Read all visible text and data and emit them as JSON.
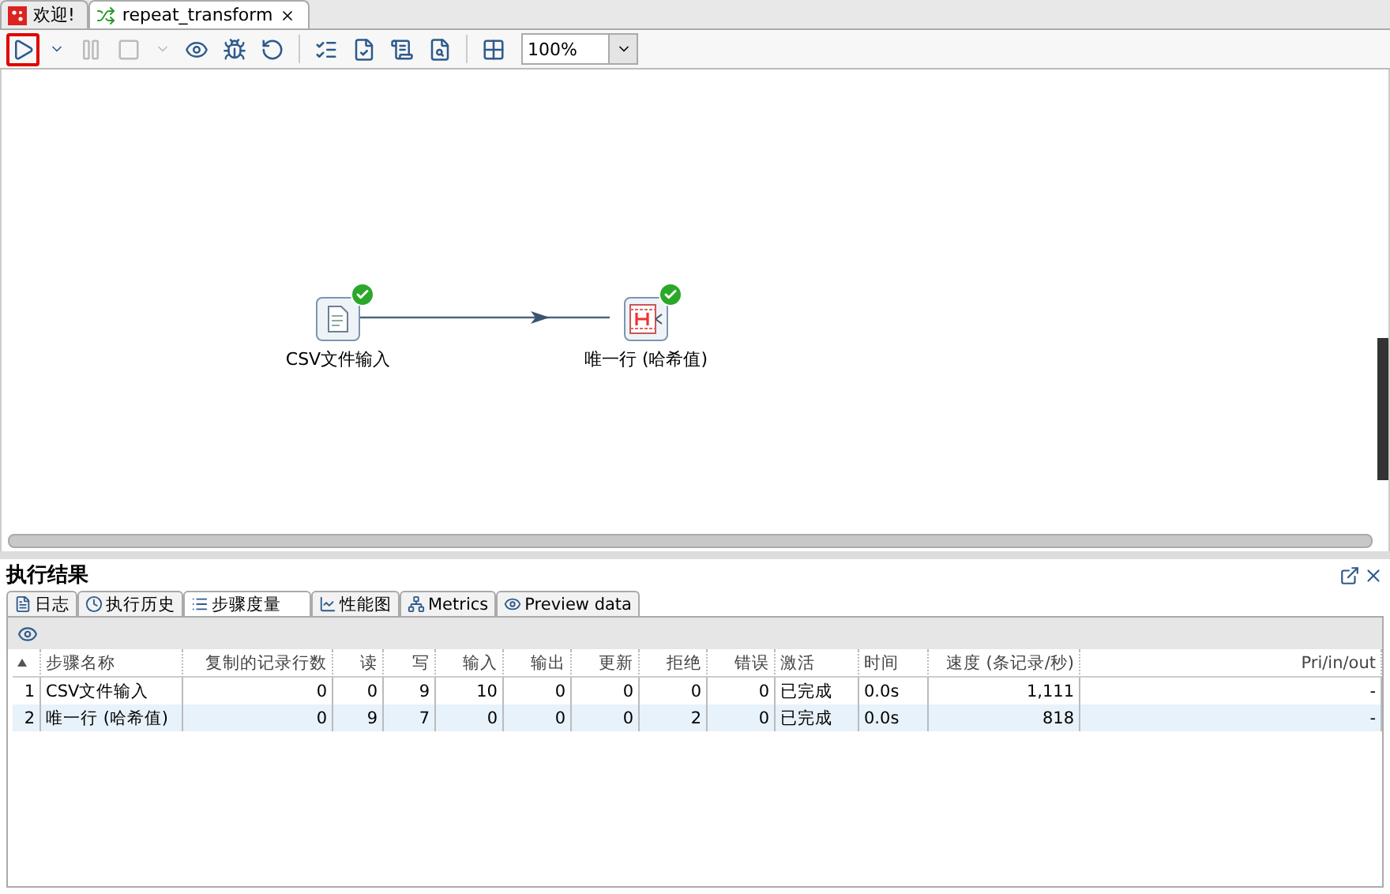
{
  "editor_tabs": [
    {
      "label": "欢迎!",
      "kind": "welcome",
      "selected": false,
      "closable": false
    },
    {
      "label": "repeat_transform",
      "kind": "transform",
      "selected": true,
      "closable": true
    }
  ],
  "toolbar": {
    "buttons": [
      {
        "kind": "run",
        "disabled": false,
        "highlighted": true
      },
      {
        "kind": "dropdown",
        "disabled": false,
        "highlighted": false
      },
      {
        "kind": "pause",
        "disabled": true,
        "highlighted": false
      },
      {
        "kind": "stop",
        "disabled": true,
        "highlighted": false
      },
      {
        "kind": "dropdown",
        "disabled": true,
        "highlighted": false
      },
      {
        "kind": "preview",
        "disabled": false,
        "highlighted": false
      },
      {
        "kind": "debug",
        "disabled": false,
        "highlighted": false
      },
      {
        "kind": "replay",
        "disabled": false,
        "highlighted": false
      },
      {
        "kind": "verify",
        "disabled": false,
        "highlighted": false
      },
      {
        "kind": "impact",
        "disabled": false,
        "highlighted": false
      },
      {
        "kind": "sql",
        "disabled": false,
        "highlighted": false
      },
      {
        "kind": "explore",
        "disabled": false,
        "highlighted": false
      },
      {
        "kind": "grid",
        "disabled": false,
        "highlighted": false
      }
    ],
    "zoom": "100%"
  },
  "canvas": {
    "nodes": [
      {
        "label": "CSV文件输入",
        "kind": "csv",
        "finished": true
      },
      {
        "label": "唯一行 (哈希值)",
        "kind": "unique",
        "finished": true
      }
    ]
  },
  "results": {
    "title": "执行结果",
    "tabs": [
      {
        "label": "日志",
        "kind": "log",
        "selected": false
      },
      {
        "label": "执行历史",
        "kind": "history",
        "selected": false
      },
      {
        "label": "步骤度量",
        "kind": "metrics",
        "selected": true
      },
      {
        "label": "性能图",
        "kind": "chart",
        "selected": false
      },
      {
        "label": "Metrics",
        "kind": "tree",
        "selected": false
      },
      {
        "label": "Preview data",
        "kind": "eye",
        "selected": false
      }
    ],
    "table": {
      "columns": [
        "",
        "步骤名称",
        "复制的记录行数",
        "读",
        "写",
        "输入",
        "输出",
        "更新",
        "拒绝",
        "错误",
        "激活",
        "时间",
        "速度 (条记录/秒)",
        "Pri/in/out"
      ],
      "rows": [
        [
          "1",
          "CSV文件输入",
          "0",
          "0",
          "9",
          "10",
          "0",
          "0",
          "0",
          "0",
          "已完成",
          "0.0s",
          "1,111",
          "-"
        ],
        [
          "2",
          "唯一行 (哈希值)",
          "0",
          "9",
          "7",
          "0",
          "0",
          "0",
          "2",
          "0",
          "已完成",
          "0.0s",
          "818",
          "-"
        ]
      ]
    }
  }
}
